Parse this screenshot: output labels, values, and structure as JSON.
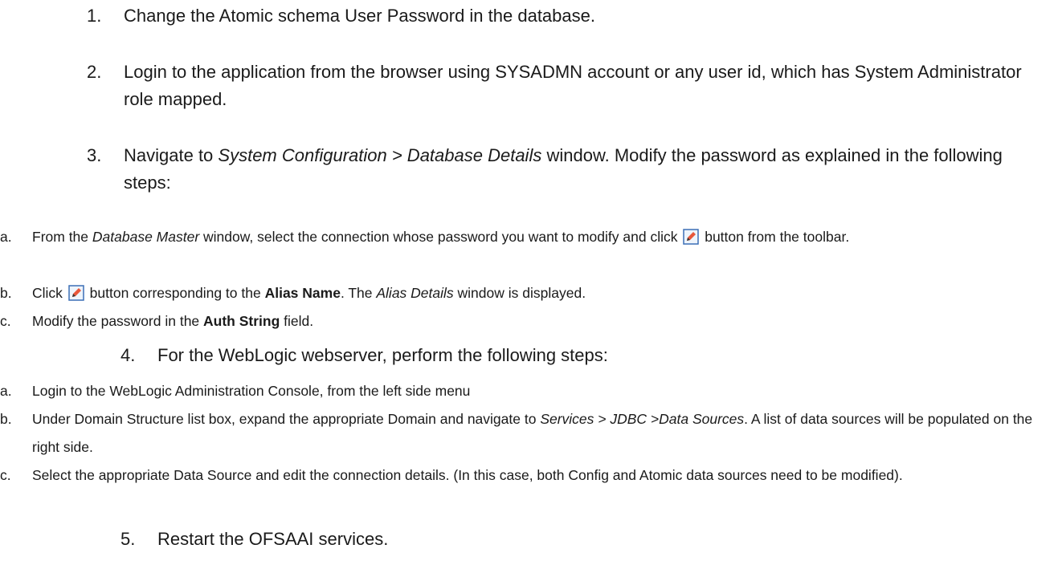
{
  "steps": [
    {
      "num": "1.",
      "text": "Change the Atomic schema User Password in the database."
    },
    {
      "num": "2.",
      "text": "Login to the application from the browser using SYSADMN account or any user id, which has System Administrator role mapped."
    },
    {
      "num": "3.",
      "pre": "Navigate to ",
      "em": "System Configuration > Database Details",
      "post": " window. Modify the password as explained in the following steps:"
    },
    {
      "num": "4.",
      "text": "For the WebLogic webserver, perform the following steps:"
    },
    {
      "num": "5.",
      "text": "Restart the OFSAAI services."
    }
  ],
  "step3_sub": {
    "a": {
      "letter": "a.",
      "p1": "From the ",
      "em1": "Database Master",
      "p2": " window, select the connection whose password you want to modify and click ",
      "p3": " button from the toolbar."
    },
    "b": {
      "letter": "b.",
      "p1": "Click ",
      "p2": " button corresponding to the ",
      "bold1": "Alias Name",
      "p3": ". The ",
      "em1": "Alias Details",
      "p4": " window is displayed."
    },
    "c": {
      "letter": "c.",
      "p1": "Modify the password in the ",
      "bold1": "Auth String",
      "p2": " field."
    }
  },
  "step4_sub": {
    "a": {
      "letter": "a.",
      "text": "Login to the WebLogic Administration Console, from the left side menu"
    },
    "b": {
      "letter": "b.",
      "p1": "Under Domain Structure list box, expand the appropriate Domain and navigate to ",
      "em1": "Services > JDBC >Data Sources",
      "p2": ". A list of data sources will be populated on the right side."
    },
    "c": {
      "letter": "c.",
      "text": "Select the appropriate Data Source and edit the connection details. (In this case, both Config and Atomic data sources need to be modified)."
    }
  },
  "icons": {
    "edit": "edit-icon"
  },
  "colors": {
    "text": "#1a1a1a",
    "icon_border": "#3b6fb6",
    "icon_pencil": "#e8573b"
  }
}
